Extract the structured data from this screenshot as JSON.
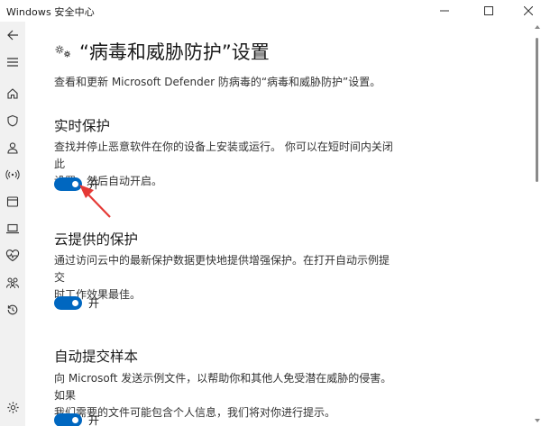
{
  "app": {
    "title": "Windows 安全中心"
  },
  "page": {
    "title": "“病毒和威胁防护”设置",
    "description": "查看和更新 Microsoft Defender 防病毒的“病毒和威胁防护”设置。"
  },
  "sections": [
    {
      "heading": "实时保护",
      "desc_line1": "查找并停止恶意软件在你的设备上安装或运行。 你可以在短时间内关闭此",
      "desc_line2": "设置，然后自动开启。",
      "toggle_label": "开",
      "toggle_on": true
    },
    {
      "heading": "云提供的保护",
      "desc_line1": "通过访问云中的最新保护数据更快地提供增强保护。在打开自动示例提交",
      "desc_line2": "时工作效果最佳。",
      "toggle_label": "开",
      "toggle_on": true
    },
    {
      "heading": "自动提交样本",
      "desc_line1": "向 Microsoft 发送示例文件，以帮助你和其他人免受潜在威胁的侵害。如果",
      "desc_line2": "我们需要的文件可能包含个人信息，我们将对你进行提示。",
      "toggle_label": "开",
      "toggle_on": true
    }
  ],
  "colors": {
    "accent": "#0067c0",
    "sidebar_bg": "#f1f1f1",
    "annotation": "#e53935"
  },
  "sidebar_icons": [
    "back-arrow-icon",
    "hamburger-menu-icon",
    "home-icon",
    "shield-icon",
    "person-icon",
    "wireless-icon",
    "app-browser-icon",
    "laptop-icon",
    "heart-pulse-icon",
    "family-icon",
    "history-icon",
    "settings-gear-icon"
  ]
}
